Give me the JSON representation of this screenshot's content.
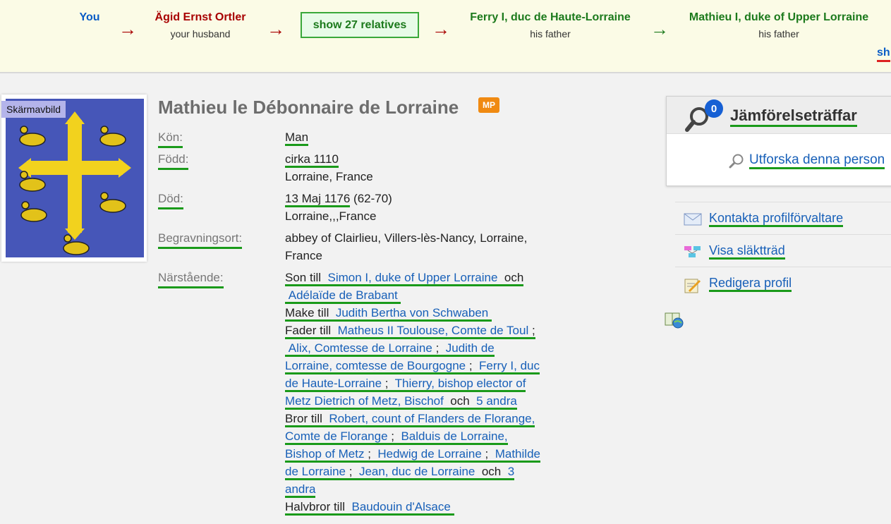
{
  "relationship": {
    "you": "You",
    "husband": {
      "name": "Ägid Ernst Ortler",
      "role": "your husband"
    },
    "show_button": "show 27 relatives",
    "father1": {
      "name": "Ferry I, duc de Haute-Lorraine",
      "role": "his father"
    },
    "father2": {
      "name": "Mathieu I, duke of Upper Lorraine",
      "role": "his father"
    },
    "arrow": "→",
    "cut_link": "sh",
    "colors": {
      "you": "#0a5cc6",
      "husband": "#a80000",
      "ancestor": "#1c7a1c"
    }
  },
  "photo": {
    "tag": "Skärmavbild"
  },
  "profile": {
    "name": "Mathieu le Débonnaire de Lorraine",
    "badge": "MP",
    "gender_label": "Kön:",
    "gender": "Man",
    "born_label": "Född:",
    "born_date": "cirka 1110",
    "born_place": "Lorraine, France",
    "died_label": "Död:",
    "died_date": "13 Maj 1176",
    "died_age": " (62-70)",
    "died_place": "Lorraine,,,France",
    "burial_label": "Begravningsort:",
    "burial_line1": "abbey of Clairlieu, Villers-lès-Nancy, Lorraine,",
    "burial_line2": "France",
    "relatives_label": "Närstående:",
    "son_of": "Son till",
    "and": "och",
    "sep": ";",
    "husband_of": "Make till",
    "father_of": "Fader till",
    "brother_of": "Bror till",
    "halfbrother_of": "Halvbror till",
    "parents": [
      "Simon I, duke of Upper Lorraine",
      "Adélaïde de Brabant"
    ],
    "wife": "Judith Bertha von Schwaben",
    "children": [
      "Matheus II Toulouse, Comte de Toul",
      "Alix, Comtesse de Lorraine",
      "Judith de",
      "Lorraine, comtesse de Bourgogne",
      "Ferry I, duc",
      "de Haute-Lorraine",
      "Thierry, bishop elector of",
      "Metz Dietrich of Metz, Bischof",
      "5 andra"
    ],
    "siblings": [
      "Robert, count of Flanders de Florange,",
      "Comte de Florange",
      "Balduis de Lorraine,",
      "Bishop of Metz",
      "Hedwig de Lorraine",
      "Mathilde",
      "de Lorraine",
      "Jean, duc de Lorraine",
      "3",
      "andra"
    ],
    "halfbrother": "Baudouin d'Alsace"
  },
  "compare": {
    "count": "0",
    "title": "Jämförelseträffar",
    "explore": "Utforska denna person"
  },
  "actions": [
    "Kontakta profilförvaltare",
    "Visa släktträd",
    "Redigera profil"
  ]
}
